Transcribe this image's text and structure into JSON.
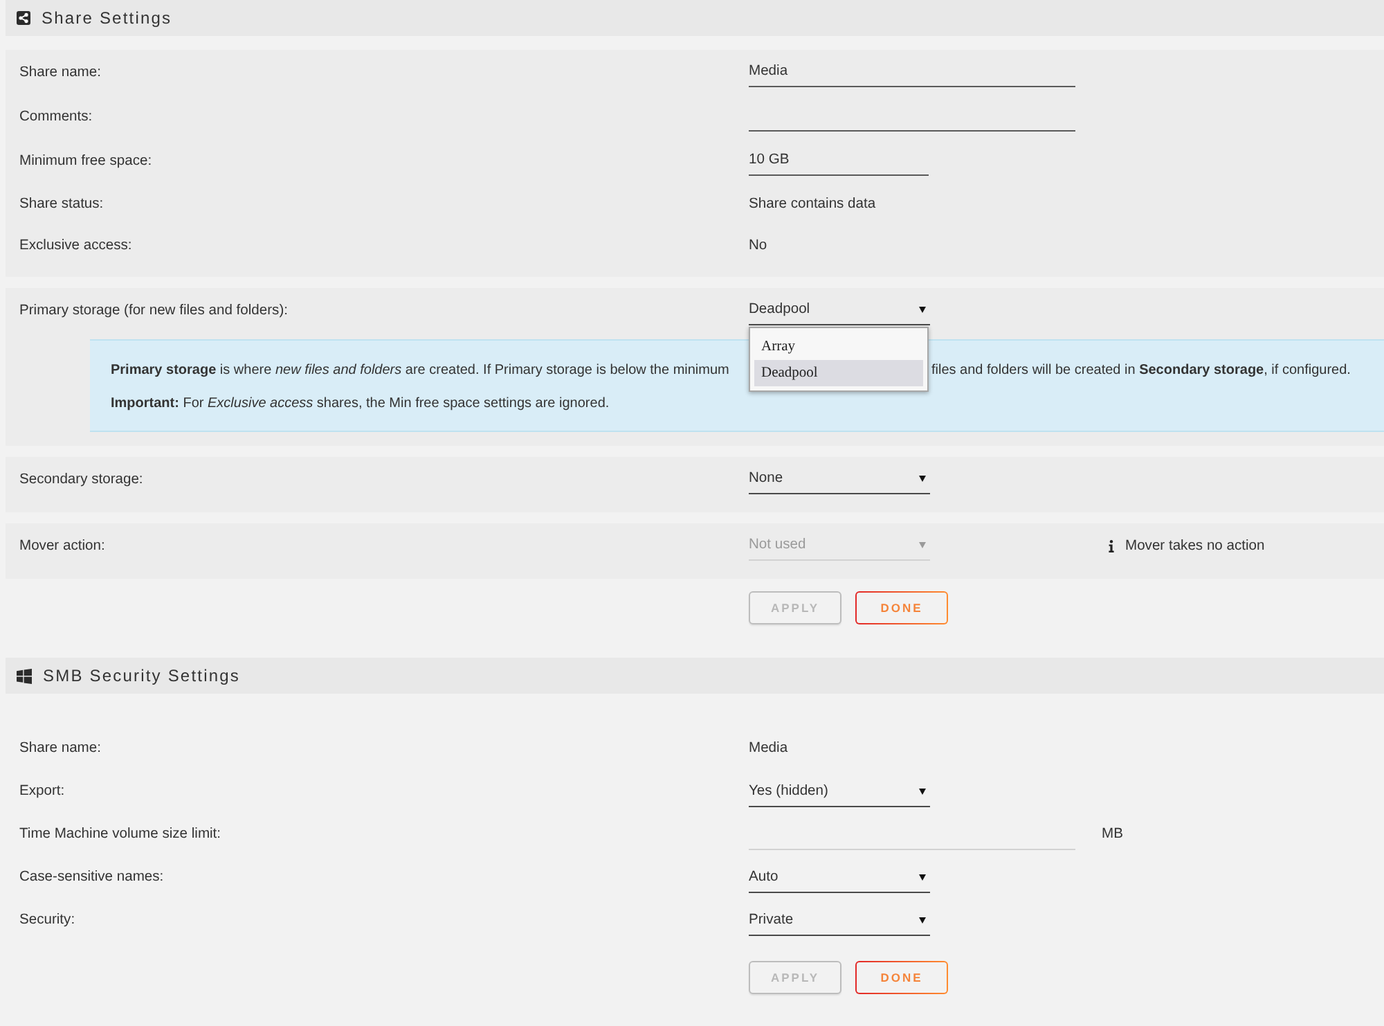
{
  "sections": [
    {
      "title": "Share Settings",
      "groups": [
        {
          "rows": [
            {
              "label": "Share name:",
              "kind": "input",
              "value": "Media",
              "disabled": false
            },
            {
              "label": "Comments:",
              "kind": "input",
              "disabled": false
            },
            {
              "label": "Minimum free space:",
              "kind": "size",
              "value": "10 GB",
              "disabled": false
            },
            {
              "label": "Share status:",
              "kind": "text",
              "value": "Share contains data"
            },
            {
              "label": "Exclusive access:",
              "kind": "text",
              "value": "No"
            }
          ]
        },
        {
          "rows": [
            {
              "label": "Primary storage (for new files and folders):",
              "kind": "select",
              "value": "Deadpool",
              "disabled": false,
              "options": [
                {
                  "label": "Array",
                  "selected": false
                },
                {
                  "label": "Deadpool",
                  "selected": true
                }
              ]
            }
          ],
          "info": {
            "lines": [
              [
                "**Primary storage** is where *new files and folders* are created. If Primary storage is below the minimum",
                "files and folders will be created in **Secondary storage**, if configured."
              ],
              [
                "**Important:** For *Exclusive access* shares, the Min free space settings are ignored."
              ]
            ]
          }
        },
        {
          "rows": [
            {
              "label": "Secondary storage:",
              "kind": "select",
              "value": "None",
              "disabled": false
            }
          ]
        },
        {
          "rows": [
            {
              "label": "Mover action:",
              "kind": "select",
              "value": "Not used",
              "disabled": true,
              "hint": "Mover takes no action"
            }
          ]
        }
      ],
      "buttons": [
        {
          "label": "APPLY",
          "disabled": true
        },
        {
          "label": "DONE",
          "disabled": false
        }
      ]
    },
    {
      "title": "SMB Security Settings",
      "rows": [
        {
          "label": "Share name:",
          "kind": "text",
          "value": "Media"
        },
        {
          "label": "Export:",
          "kind": "select",
          "value": "Yes (hidden)",
          "disabled": false
        },
        {
          "label": "Time Machine volume size limit:",
          "kind": "input",
          "disabled": true,
          "unit": "MB"
        },
        {
          "label": "Case-sensitive names:",
          "kind": "select",
          "value": "Auto",
          "disabled": false
        },
        {
          "label": "Security:",
          "kind": "select",
          "value": "Private",
          "disabled": false
        }
      ],
      "buttons": [
        {
          "label": "APPLY",
          "disabled": true
        },
        {
          "label": "DONE",
          "disabled": false
        }
      ]
    }
  ]
}
